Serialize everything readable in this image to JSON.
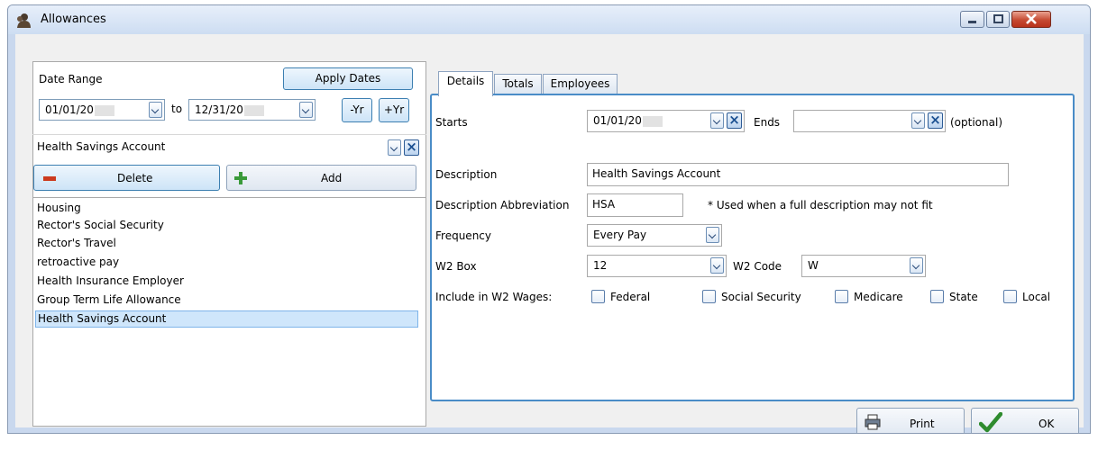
{
  "window": {
    "title": "Allowances",
    "title_icon": "person-icon"
  },
  "left": {
    "date_range_label": "Date Range",
    "apply_dates_label": "Apply Dates",
    "start_date": "01/01/20",
    "to_label": "to",
    "end_date": "12/31/20",
    "minus_year_label": "-Yr",
    "plus_year_label": "+Yr",
    "selected_allowance": "Health Savings Account",
    "delete_label": "Delete",
    "add_label": "Add",
    "items": [
      {
        "label": "Housing"
      },
      {
        "label": "Rector's Social Security"
      },
      {
        "label": "Rector's Travel"
      },
      {
        "label": "retroactive pay"
      },
      {
        "label": "Health Insurance Employer"
      },
      {
        "label": "Group Term Life Allowance"
      },
      {
        "label": "Health Savings Account"
      }
    ],
    "selected_index": 6
  },
  "tabs": [
    {
      "label": "Details"
    },
    {
      "label": "Totals"
    },
    {
      "label": "Employees"
    }
  ],
  "active_tab": "Details",
  "details": {
    "starts_label": "Starts",
    "starts_value": "01/01/20",
    "ends_label": "Ends",
    "ends_value": "",
    "optional_label": "(optional)",
    "description_label": "Description",
    "description_value": "Health Savings Account",
    "abbrev_label": "Description Abbreviation",
    "abbrev_value": "HSA",
    "abbrev_note": "* Used when a full description may not fit",
    "frequency_label": "Frequency",
    "frequency_value": "Every Pay",
    "w2box_label": "W2 Box",
    "w2box_value": "12",
    "w2code_label": "W2 Code",
    "w2code_value": "W",
    "include_label": "Include in W2 Wages:",
    "checkboxes": [
      {
        "label": "Federal",
        "checked": false
      },
      {
        "label": "Social Security",
        "checked": false
      },
      {
        "label": "Medicare",
        "checked": false
      },
      {
        "label": "State",
        "checked": false
      },
      {
        "label": "Local",
        "checked": false
      }
    ]
  },
  "footer": {
    "print_label": "Print",
    "ok_label": "OK"
  },
  "colors": {
    "selection": "#cfe6fb",
    "accent": "#3c7fb1",
    "ok_check": "#2e8b2e",
    "delete_icon": "#cc3a1e",
    "add_icon": "#3a9a3a"
  }
}
